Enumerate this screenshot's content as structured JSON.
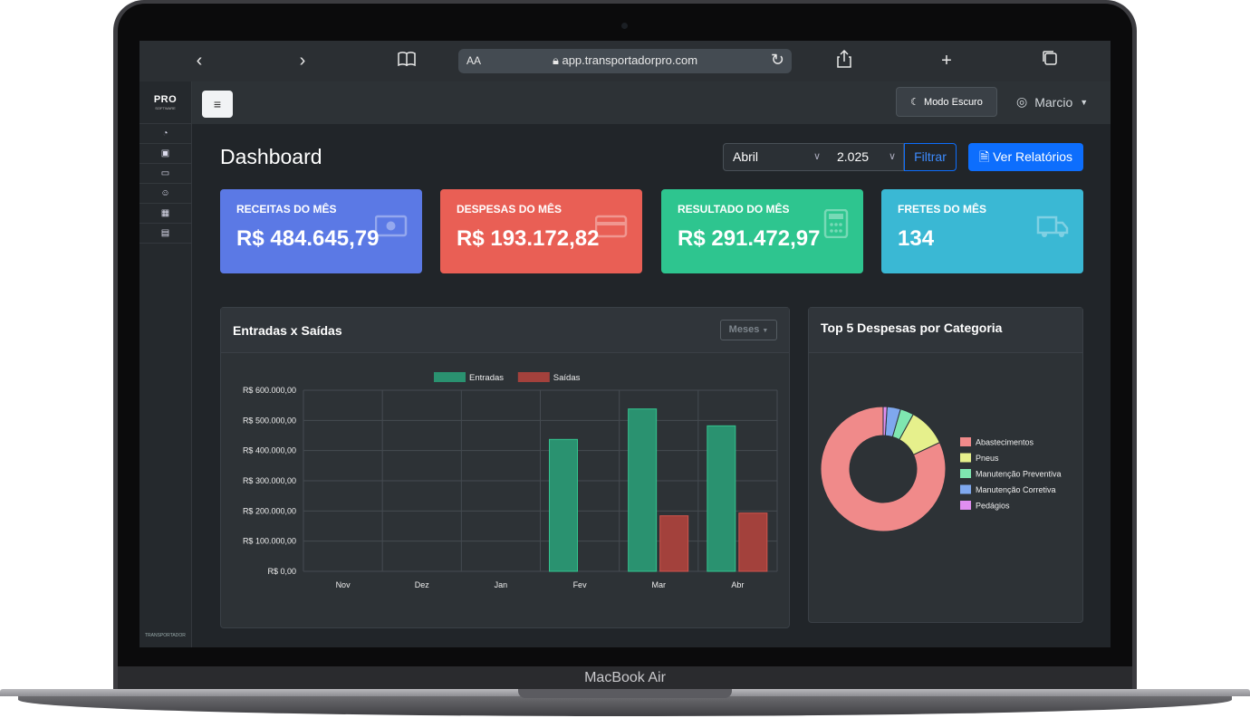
{
  "device": {
    "label": "MacBook Air"
  },
  "browser": {
    "font_size_label": "AA",
    "url": "app.transportadorpro.com",
    "icons": [
      "chevron-left",
      "chevron-right",
      "book",
      "lock",
      "reload",
      "share",
      "plus",
      "tabs"
    ]
  },
  "sidebar": {
    "brand": "PRO",
    "brand_sub": "SOFTWARE",
    "items": [
      "dashboard-icon",
      "money-icon",
      "truck-icon",
      "users-icon",
      "building-icon",
      "document-icon"
    ],
    "footer": "TRANSPORTADOR"
  },
  "topnav": {
    "menu_icon": "hamburger",
    "dark_mode_label": "Modo Escuro",
    "user_name": "Marcio"
  },
  "page": {
    "title": "Dashboard",
    "month_select": "Abril",
    "year_select": "2.025",
    "filter_label": "Filtrar",
    "reports_label": "Ver Relatórios"
  },
  "cards": [
    {
      "label": "RECEITAS DO MÊS",
      "value": "R$ 484.645,79",
      "color": "#5b79e5",
      "icon": "money-icon"
    },
    {
      "label": "DESPESAS DO MÊS",
      "value": "R$ 193.172,82",
      "color": "#e95f55",
      "icon": "credit-card-icon"
    },
    {
      "label": "RESULTADO DO MÊS",
      "value": "R$ 291.472,97",
      "color": "#2ec58f",
      "icon": "calculator-icon"
    },
    {
      "label": "FRETES DO MÊS",
      "value": "134",
      "color": "#3ab8d4",
      "icon": "truck-icon"
    }
  ],
  "bar_panel": {
    "title": "Entradas x Saídas",
    "dropdown": "Meses"
  },
  "pie_panel": {
    "title": "Top 5 Despesas por Categoria"
  },
  "chart_data": [
    {
      "type": "bar",
      "categories": [
        "Nov",
        "Dez",
        "Jan",
        "Fev",
        "Mar",
        "Abr"
      ],
      "series": [
        {
          "name": "Entradas",
          "color": "#2a9270",
          "values": [
            0,
            0,
            0,
            437000,
            538000,
            482000
          ]
        },
        {
          "name": "Saídas",
          "color": "#a3413c",
          "values": [
            0,
            0,
            0,
            0,
            184000,
            193000
          ]
        }
      ],
      "ylim": [
        0,
        600000
      ],
      "yticks": [
        "R$ 0,00",
        "R$ 100.000,00",
        "R$ 200.000,00",
        "R$ 300.000,00",
        "R$ 400.000,00",
        "R$ 500.000,00",
        "R$ 600.000,00"
      ],
      "legend": "top",
      "grid": true
    },
    {
      "type": "pie",
      "variant": "doughnut",
      "labels": [
        "Abastecimentos",
        "Pneus",
        "Manutenção Preventiva",
        "Manutenção Corretiva",
        "Pedágios"
      ],
      "values": [
        82,
        10,
        3.5,
        3.5,
        1
      ],
      "colors": [
        "#f08a8a",
        "#e6f08c",
        "#7fe6b0",
        "#7fa8ee",
        "#e08ef0"
      ],
      "legend": "right"
    }
  ]
}
